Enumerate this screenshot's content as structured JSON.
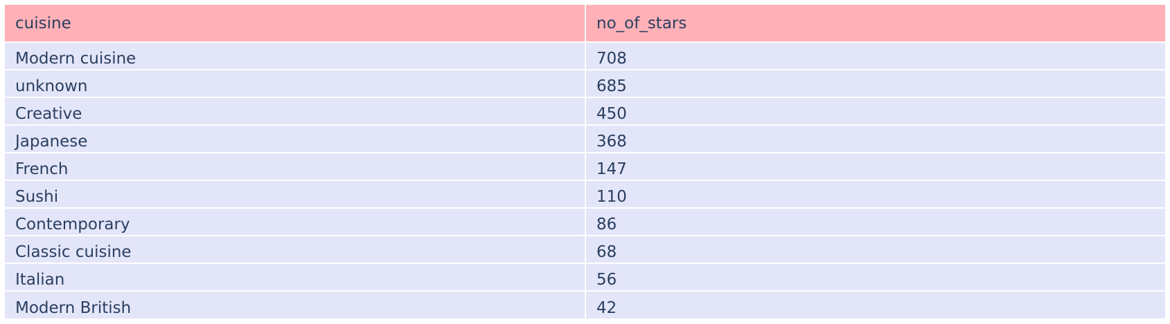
{
  "colors": {
    "header_fill": "#ffb1b7",
    "cell_fill": "#e3e5f9",
    "text": "#2a3f5f",
    "line": "#ffffff"
  },
  "chart_data": {
    "type": "table",
    "columns": [
      "cuisine",
      "no_of_stars"
    ],
    "rows": [
      [
        "Modern cuisine",
        "708"
      ],
      [
        "unknown",
        "685"
      ],
      [
        "Creative",
        "450"
      ],
      [
        "Japanese",
        "368"
      ],
      [
        "French",
        "147"
      ],
      [
        "Sushi",
        "110"
      ],
      [
        "Contemporary",
        "86"
      ],
      [
        "Classic cuisine",
        "68"
      ],
      [
        "Italian",
        "56"
      ],
      [
        "Modern British",
        "42"
      ]
    ]
  }
}
